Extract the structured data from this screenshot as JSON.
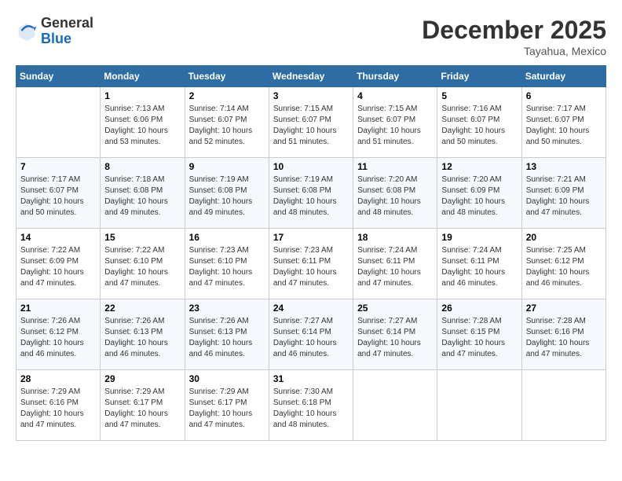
{
  "header": {
    "logo_line1": "General",
    "logo_line2": "Blue",
    "month_year": "December 2025",
    "location": "Tayahua, Mexico"
  },
  "weekdays": [
    "Sunday",
    "Monday",
    "Tuesday",
    "Wednesday",
    "Thursday",
    "Friday",
    "Saturday"
  ],
  "weeks": [
    [
      {
        "num": "",
        "info": ""
      },
      {
        "num": "1",
        "info": "Sunrise: 7:13 AM\nSunset: 6:06 PM\nDaylight: 10 hours\nand 53 minutes."
      },
      {
        "num": "2",
        "info": "Sunrise: 7:14 AM\nSunset: 6:07 PM\nDaylight: 10 hours\nand 52 minutes."
      },
      {
        "num": "3",
        "info": "Sunrise: 7:15 AM\nSunset: 6:07 PM\nDaylight: 10 hours\nand 51 minutes."
      },
      {
        "num": "4",
        "info": "Sunrise: 7:15 AM\nSunset: 6:07 PM\nDaylight: 10 hours\nand 51 minutes."
      },
      {
        "num": "5",
        "info": "Sunrise: 7:16 AM\nSunset: 6:07 PM\nDaylight: 10 hours\nand 50 minutes."
      },
      {
        "num": "6",
        "info": "Sunrise: 7:17 AM\nSunset: 6:07 PM\nDaylight: 10 hours\nand 50 minutes."
      }
    ],
    [
      {
        "num": "7",
        "info": "Sunrise: 7:17 AM\nSunset: 6:07 PM\nDaylight: 10 hours\nand 50 minutes."
      },
      {
        "num": "8",
        "info": "Sunrise: 7:18 AM\nSunset: 6:08 PM\nDaylight: 10 hours\nand 49 minutes."
      },
      {
        "num": "9",
        "info": "Sunrise: 7:19 AM\nSunset: 6:08 PM\nDaylight: 10 hours\nand 49 minutes."
      },
      {
        "num": "10",
        "info": "Sunrise: 7:19 AM\nSunset: 6:08 PM\nDaylight: 10 hours\nand 48 minutes."
      },
      {
        "num": "11",
        "info": "Sunrise: 7:20 AM\nSunset: 6:08 PM\nDaylight: 10 hours\nand 48 minutes."
      },
      {
        "num": "12",
        "info": "Sunrise: 7:20 AM\nSunset: 6:09 PM\nDaylight: 10 hours\nand 48 minutes."
      },
      {
        "num": "13",
        "info": "Sunrise: 7:21 AM\nSunset: 6:09 PM\nDaylight: 10 hours\nand 47 minutes."
      }
    ],
    [
      {
        "num": "14",
        "info": "Sunrise: 7:22 AM\nSunset: 6:09 PM\nDaylight: 10 hours\nand 47 minutes."
      },
      {
        "num": "15",
        "info": "Sunrise: 7:22 AM\nSunset: 6:10 PM\nDaylight: 10 hours\nand 47 minutes."
      },
      {
        "num": "16",
        "info": "Sunrise: 7:23 AM\nSunset: 6:10 PM\nDaylight: 10 hours\nand 47 minutes."
      },
      {
        "num": "17",
        "info": "Sunrise: 7:23 AM\nSunset: 6:11 PM\nDaylight: 10 hours\nand 47 minutes."
      },
      {
        "num": "18",
        "info": "Sunrise: 7:24 AM\nSunset: 6:11 PM\nDaylight: 10 hours\nand 47 minutes."
      },
      {
        "num": "19",
        "info": "Sunrise: 7:24 AM\nSunset: 6:11 PM\nDaylight: 10 hours\nand 46 minutes."
      },
      {
        "num": "20",
        "info": "Sunrise: 7:25 AM\nSunset: 6:12 PM\nDaylight: 10 hours\nand 46 minutes."
      }
    ],
    [
      {
        "num": "21",
        "info": "Sunrise: 7:26 AM\nSunset: 6:12 PM\nDaylight: 10 hours\nand 46 minutes."
      },
      {
        "num": "22",
        "info": "Sunrise: 7:26 AM\nSunset: 6:13 PM\nDaylight: 10 hours\nand 46 minutes."
      },
      {
        "num": "23",
        "info": "Sunrise: 7:26 AM\nSunset: 6:13 PM\nDaylight: 10 hours\nand 46 minutes."
      },
      {
        "num": "24",
        "info": "Sunrise: 7:27 AM\nSunset: 6:14 PM\nDaylight: 10 hours\nand 46 minutes."
      },
      {
        "num": "25",
        "info": "Sunrise: 7:27 AM\nSunset: 6:14 PM\nDaylight: 10 hours\nand 47 minutes."
      },
      {
        "num": "26",
        "info": "Sunrise: 7:28 AM\nSunset: 6:15 PM\nDaylight: 10 hours\nand 47 minutes."
      },
      {
        "num": "27",
        "info": "Sunrise: 7:28 AM\nSunset: 6:16 PM\nDaylight: 10 hours\nand 47 minutes."
      }
    ],
    [
      {
        "num": "28",
        "info": "Sunrise: 7:29 AM\nSunset: 6:16 PM\nDaylight: 10 hours\nand 47 minutes."
      },
      {
        "num": "29",
        "info": "Sunrise: 7:29 AM\nSunset: 6:17 PM\nDaylight: 10 hours\nand 47 minutes."
      },
      {
        "num": "30",
        "info": "Sunrise: 7:29 AM\nSunset: 6:17 PM\nDaylight: 10 hours\nand 47 minutes."
      },
      {
        "num": "31",
        "info": "Sunrise: 7:30 AM\nSunset: 6:18 PM\nDaylight: 10 hours\nand 48 minutes."
      },
      {
        "num": "",
        "info": ""
      },
      {
        "num": "",
        "info": ""
      },
      {
        "num": "",
        "info": ""
      }
    ]
  ]
}
